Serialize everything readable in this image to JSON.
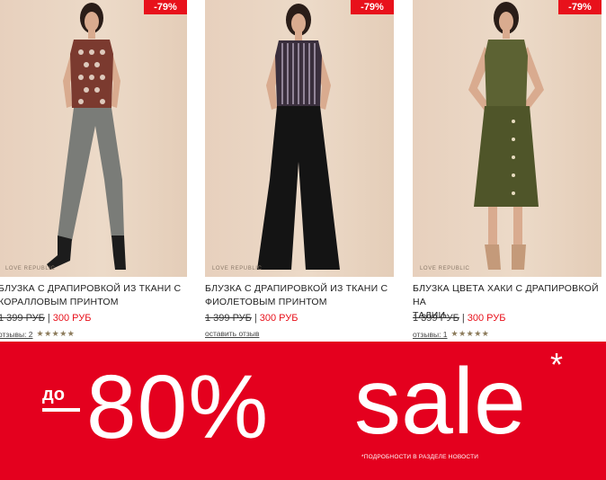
{
  "products": [
    {
      "discount": "-79%",
      "brand": "LOVE REPUBLIC",
      "name": "БЛУЗКА С ДРАПИРОВКОЙ ИЗ ТКАНИ С КОРАЛЛОВЫМ ПРИНТОМ",
      "name_line1": "БЛУЗКА С ДРАПИРОВКОЙ ИЗ ТКАНИ С",
      "name_line2": "КОРАЛЛОВЫМ ПРИНТОМ",
      "old_price": "1 399 РУБ",
      "price_separator": "|",
      "new_price": "300 РУБ",
      "reviews_text": "отзывы: 2",
      "rating": 4.5,
      "stars": "★★★★★"
    },
    {
      "discount": "-79%",
      "brand": "LOVE REPUBLIC",
      "name": "БЛУЗКА С ДРАПИРОВКОЙ ИЗ ТКАНИ С ФИОЛЕТОВЫМ ПРИНТОМ",
      "name_line1": "БЛУЗКА С ДРАПИРОВКОЙ ИЗ ТКАНИ С",
      "name_line2": "ФИОЛЕТОВЫМ ПРИНТОМ",
      "old_price": "1 399 РУБ",
      "price_separator": "|",
      "new_price": "300 РУБ",
      "reviews_text": "оставить отзыв"
    },
    {
      "discount": "-79%",
      "brand": "LOVE REPUBLIC",
      "name": "БЛУЗКА ЦВЕТА ХАКИ С ДРАПИРОВКОЙ НА ТАЛИИ",
      "name_line1": "БЛУЗКА ЦВЕТА ХАКИ С ДРАПИРОВКОЙ НА",
      "name_line2": "ТАЛИИ",
      "old_price": "1 399 РУБ",
      "price_separator": "|",
      "new_price": "300 РУБ",
      "reviews_text": "отзывы: 1",
      "rating": 5,
      "stars": "★★★★★"
    }
  ],
  "banner": {
    "prefix": "до",
    "amount": "80%",
    "word": "sale",
    "asterisk": "*",
    "note": "*ПОДРОБНОСТИ В РАЗДЕЛЕ НОВОСТИ"
  },
  "colors": {
    "accent_red": "#e4001e",
    "sale_price": "#e8111b",
    "star": "#8b7a5a",
    "photo_bg": "#e9d4c1"
  }
}
